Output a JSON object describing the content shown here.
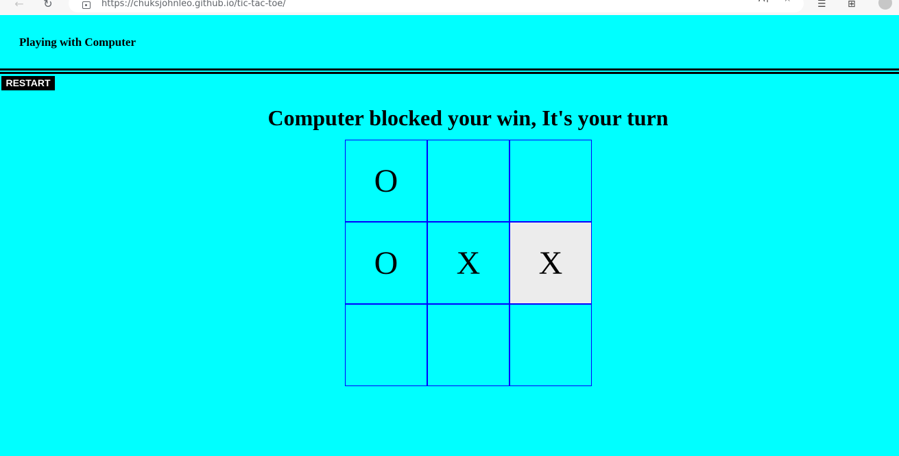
{
  "browser": {
    "url": "https://chuksjohnleo.github.io/tic-tac-toe/",
    "icons": [
      "back-icon",
      "reload-icon",
      "site-info-icon",
      "read-aloud-icon",
      "favorite-add-icon",
      "favorites-icon",
      "collections-icon",
      "profile-avatar"
    ]
  },
  "header": {
    "title": "Playing with Computer"
  },
  "controls": {
    "restart_label": "RESTART"
  },
  "status": {
    "message": "Computer blocked your win, It's your turn"
  },
  "board": {
    "cells": [
      "O",
      "",
      "",
      "O",
      "X",
      "X",
      "",
      "",
      ""
    ],
    "highlighted_cell": 5
  },
  "colors": {
    "background": "#00ffff",
    "grid_line": "#0000ff",
    "highlight": "#ececec",
    "button_bg": "#000000",
    "button_text": "#ffffff"
  }
}
